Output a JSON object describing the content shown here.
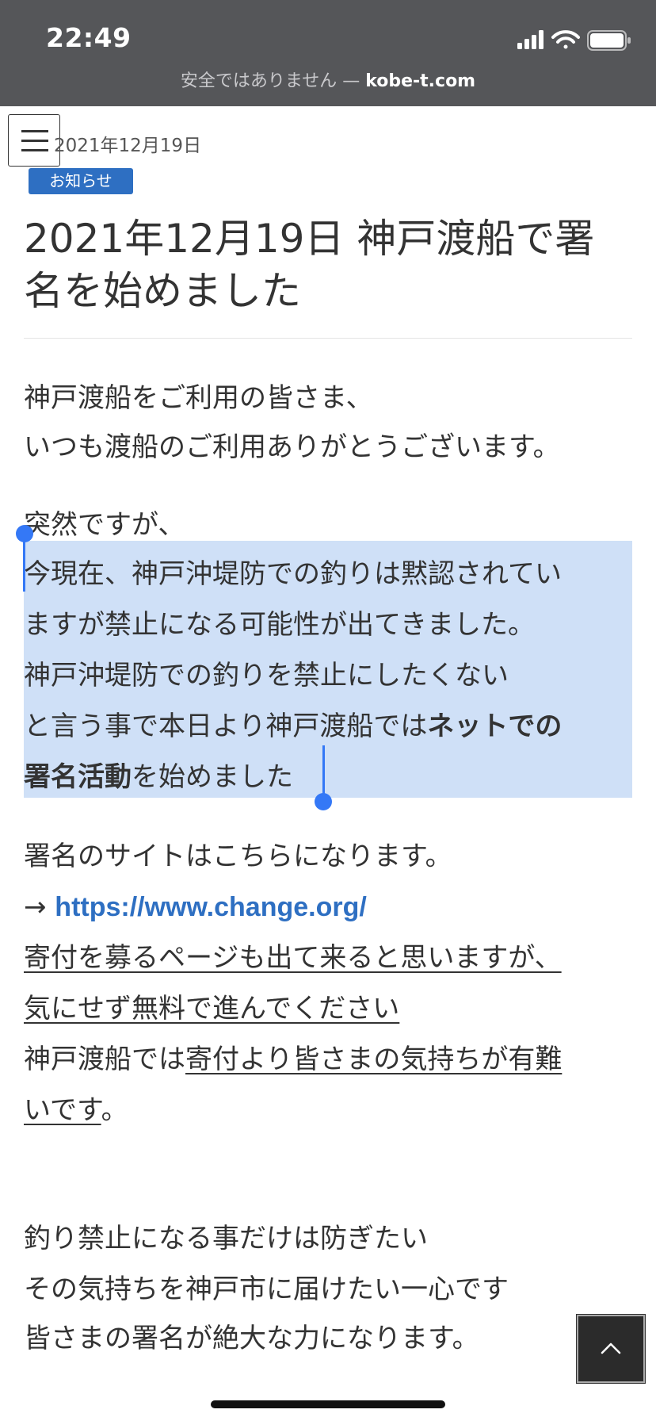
{
  "status_bar": {
    "time": "22:49"
  },
  "url_bar": {
    "security_text": "安全ではありません —",
    "domain": "kobe-t.com"
  },
  "post": {
    "date": "2021年12月19日",
    "category": "お知らせ",
    "title_line1": "2021年12月19日 神戸渡船で署",
    "title_line2": "名を始めました"
  },
  "body": {
    "p1_l1": "神戸渡船をご利用の皆さま、",
    "p1_l2": "いつも渡船のご利用ありがとうございます。",
    "p2_l1": "突然ですが、",
    "p2_l2": "今現在、神戸沖堤防での釣りは黙認されてい",
    "p2_l3": "ますが禁止になる可能性が出てきました。",
    "p2_l4": "神戸沖堤防での釣りを禁止にしたくない",
    "p2_l5a": "と言う事で本日より神戸渡船では",
    "p2_l5b": "ネットでの",
    "p2_l6a": "署名活動",
    "p2_l6b": "を始めました",
    "p3_l1": "署名のサイトはこちらになります。",
    "p3_arrow": "→ ",
    "p3_link": "https://www.change.org/",
    "p3_l3": "寄付を募るページも出て来ると思いますが、",
    "p3_l4": "気にせず無料で進んでください",
    "p3_l5a": "神戸渡船では",
    "p3_l5b": "寄付より皆さまの気持ちが有難",
    "p3_l6a": "いです",
    "p3_l6b": "。",
    "p4_l1": "釣り禁止になる事だけは防ぎたい",
    "p4_l2": "その気持ちを神戸市に届けたい一心です",
    "p4_l3": "皆さまの署名が絶大な力になります。"
  },
  "icons": {
    "menu": "hamburger-menu-icon",
    "back_to_top": "chevron-up-icon",
    "signal": "cellular-signal-icon",
    "wifi": "wifi-icon",
    "battery": "battery-icon"
  },
  "colors": {
    "status_bar": "#555659",
    "accent": "#2e6fc2",
    "selection": "#cfe0f7",
    "selection_handle": "#3478f6"
  }
}
